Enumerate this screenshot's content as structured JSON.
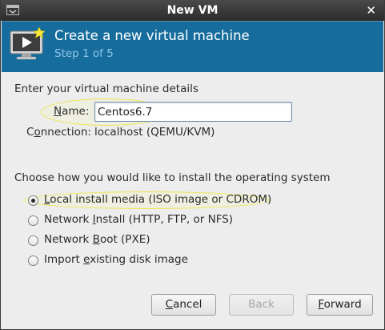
{
  "window": {
    "title": "New VM",
    "close_glyph": "✕"
  },
  "banner": {
    "icon": "new-vm-monitor-icon",
    "title": "Create a new virtual machine",
    "step": "Step 1 of 5"
  },
  "details": {
    "heading": "Enter your virtual machine details",
    "name_label_mnemonic": "N",
    "name_label_rest": "ame:",
    "name_value": "Centos6.7",
    "connection_label_pre": "C",
    "connection_label_mnemonic": "o",
    "connection_label_rest": "nnection:",
    "connection_value": "localhost (QEMU/KVM)"
  },
  "install": {
    "heading": "Choose how you would like to install the operating system",
    "options": [
      {
        "pre": "",
        "mnemonic": "L",
        "rest": "ocal install media (ISO image or CDROM)",
        "checked": true
      },
      {
        "pre": "Network ",
        "mnemonic": "I",
        "rest": "nstall (HTTP, FTP, or NFS)",
        "checked": false
      },
      {
        "pre": "Network ",
        "mnemonic": "B",
        "rest": "oot (PXE)",
        "checked": false
      },
      {
        "pre": "Import ",
        "mnemonic": "e",
        "rest": "xisting disk image",
        "checked": false
      }
    ]
  },
  "buttons": {
    "cancel_mnemonic": "C",
    "cancel_rest": "ancel",
    "back": "Back",
    "forward_mnemonic": "F",
    "forward_rest": "orward"
  },
  "colors": {
    "banner_bg": "#166d9d",
    "banner_step": "#8ec6e8",
    "highlight": "#ece54a"
  }
}
